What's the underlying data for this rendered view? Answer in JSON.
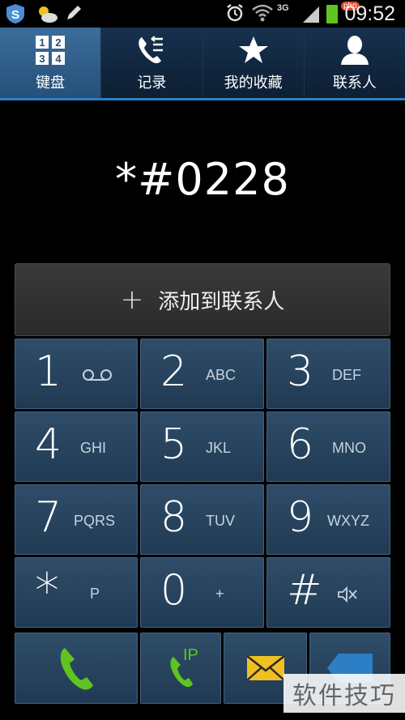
{
  "status_bar": {
    "time": "09:52",
    "network": "3G",
    "badge": "php"
  },
  "tabs": [
    {
      "label": "键盘",
      "icon": "keypad-icon",
      "active": true
    },
    {
      "label": "记录",
      "icon": "call-log-icon",
      "active": false
    },
    {
      "label": "我的收藏",
      "icon": "star-icon",
      "active": false
    },
    {
      "label": "联系人",
      "icon": "person-icon",
      "active": false
    }
  ],
  "dialed_number": "*#0228",
  "add_contact": {
    "plus": "+",
    "label": "添加到联系人"
  },
  "keys": [
    {
      "digit": "1",
      "letters": "",
      "sub_icon": "voicemail-icon"
    },
    {
      "digit": "2",
      "letters": "ABC"
    },
    {
      "digit": "3",
      "letters": "DEF"
    },
    {
      "digit": "4",
      "letters": "GHI"
    },
    {
      "digit": "5",
      "letters": "JKL"
    },
    {
      "digit": "6",
      "letters": "MNO"
    },
    {
      "digit": "7",
      "letters": "PQRS"
    },
    {
      "digit": "8",
      "letters": "TUV"
    },
    {
      "digit": "9",
      "letters": "WXYZ"
    },
    {
      "digit": "*",
      "letters": "P"
    },
    {
      "digit": "0",
      "letters": "+"
    },
    {
      "digit": "#",
      "letters": "",
      "sub_icon": "mute-icon"
    }
  ],
  "bottom": {
    "ip_label": "IP"
  },
  "watermark": "软件技巧",
  "colors": {
    "tab_active": "#3c6d9a",
    "tab_indicator": "#2c7fc4",
    "key_bg": "#2a4662",
    "call_green": "#5fc41f"
  }
}
